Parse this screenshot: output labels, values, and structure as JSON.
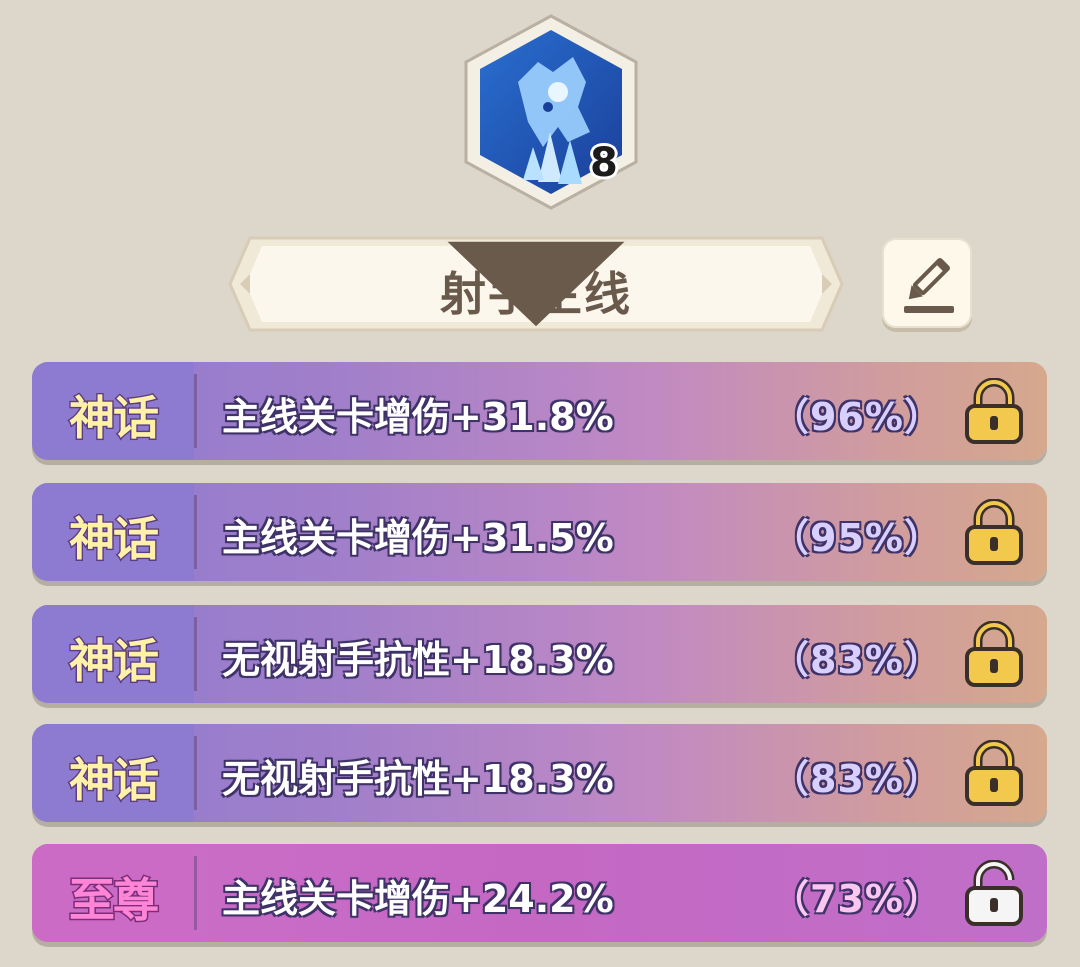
{
  "hero": {
    "level": "8",
    "portrait_icon": "ice-spirit-portrait-icon"
  },
  "build_selector": {
    "selected": "射手主线"
  },
  "edit_button": {
    "icon": "pencil-edit-icon"
  },
  "colors": {
    "myth_tier": "#8c7bd0",
    "supreme_tier": "#cc6bc5",
    "lock_gold": "#f2c94c",
    "unlock_white": "#f5f5f5"
  },
  "affixes": [
    {
      "tier": "神话",
      "stat": "主线关卡增伤+31.8%",
      "percent": "（96%）",
      "lock_state": "locked"
    },
    {
      "tier": "神话",
      "stat": "主线关卡增伤+31.5%",
      "percent": "（95%）",
      "lock_state": "locked"
    },
    {
      "tier": "神话",
      "stat": "无视射手抗性+18.3%",
      "percent": "（83%）",
      "lock_state": "locked"
    },
    {
      "tier": "神话",
      "stat": "无视射手抗性+18.3%",
      "percent": "（83%）",
      "lock_state": "locked"
    },
    {
      "tier": "至尊",
      "stat": "主线关卡增伤+24.2%",
      "percent": "（73%）",
      "lock_state": "unlocked"
    }
  ]
}
